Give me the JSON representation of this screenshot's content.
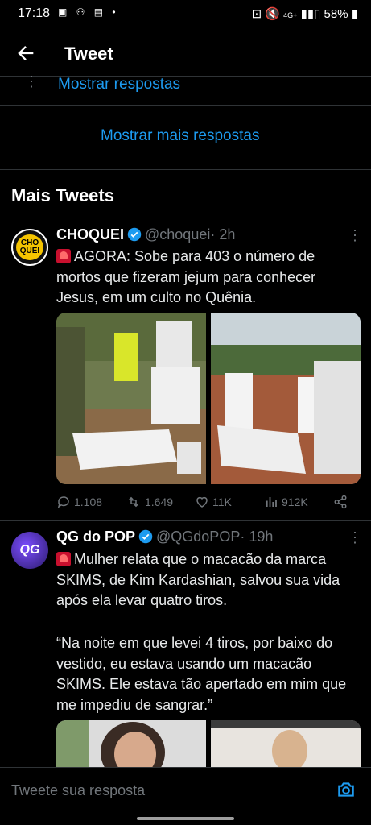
{
  "status_bar": {
    "time": "17:18",
    "battery": "58%",
    "signal": "4G+"
  },
  "header": {
    "title": "Tweet"
  },
  "show_replies": "Mostrar respostas",
  "show_more_replies": "Mostrar mais respostas",
  "section_title": "Mais Tweets",
  "tweets": [
    {
      "name": "CHOQUEI",
      "handle": "@choquei",
      "time": "· 2h",
      "avatar_text": "CHO QUEI",
      "text": "AGORA: Sobe para 403 o número de mortos que fizeram jejum para conhecer Jesus, em um culto no Quênia.",
      "replies": "1.108",
      "retweets": "1.649",
      "likes": "11K",
      "views": "912K"
    },
    {
      "name": "QG do POP",
      "handle": "@QGdoPOP",
      "time": "· 19h",
      "avatar_text": "QG",
      "text": "Mulher relata que o macacão da marca SKIMS, de Kim Kardashian, salvou sua vida após ela levar quatro tiros.",
      "quote": "“Na noite em que levei 4 tiros, por baixo do vestido, eu estava usando um macacão SKIMS. Ele estava tão apertado em mim que me impediu de sangrar.”"
    }
  ],
  "reply_placeholder": "Tweete sua resposta",
  "colors": {
    "accent": "#1d9bf0",
    "muted": "#71767b",
    "background": "#000000"
  }
}
